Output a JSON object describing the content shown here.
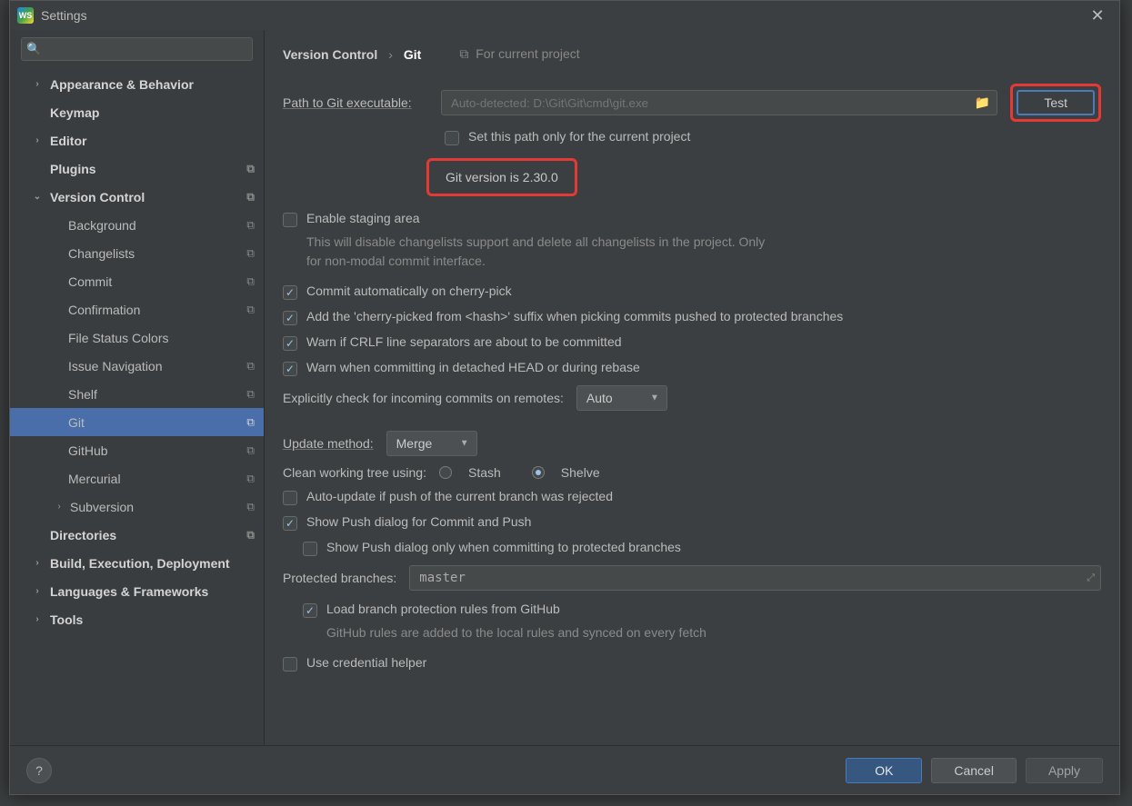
{
  "window": {
    "title": "Settings",
    "app_icon_text": "WS"
  },
  "sidebar": {
    "search_placeholder": "",
    "items": [
      {
        "label": "Appearance & Behavior",
        "level": "top",
        "arrow": "right"
      },
      {
        "label": "Keymap",
        "level": "top",
        "arrow": ""
      },
      {
        "label": "Editor",
        "level": "top",
        "arrow": "right"
      },
      {
        "label": "Plugins",
        "level": "top",
        "arrow": "",
        "copy": true
      },
      {
        "label": "Version Control",
        "level": "top",
        "arrow": "down",
        "copy": true
      },
      {
        "label": "Background",
        "level": "sub",
        "copy": true
      },
      {
        "label": "Changelists",
        "level": "sub",
        "copy": true
      },
      {
        "label": "Commit",
        "level": "sub",
        "copy": true
      },
      {
        "label": "Confirmation",
        "level": "sub",
        "copy": true
      },
      {
        "label": "File Status Colors",
        "level": "sub"
      },
      {
        "label": "Issue Navigation",
        "level": "sub",
        "copy": true
      },
      {
        "label": "Shelf",
        "level": "sub",
        "copy": true
      },
      {
        "label": "Git",
        "level": "sub",
        "copy": true,
        "selected": true
      },
      {
        "label": "GitHub",
        "level": "sub",
        "copy": true
      },
      {
        "label": "Mercurial",
        "level": "sub",
        "copy": true
      },
      {
        "label": "Subversion",
        "level": "sub2",
        "arrow": "right",
        "copy": true
      },
      {
        "label": "Directories",
        "level": "top",
        "arrow": "",
        "copy": true
      },
      {
        "label": "Build, Execution, Deployment",
        "level": "top",
        "arrow": "right"
      },
      {
        "label": "Languages & Frameworks",
        "level": "top",
        "arrow": "right"
      },
      {
        "label": "Tools",
        "level": "top",
        "arrow": "right"
      }
    ]
  },
  "breadcrumb": {
    "a": "Version Control",
    "b": "Git",
    "project_label": "For current project"
  },
  "git": {
    "path_label": "Path to Git executable:",
    "path_placeholder": "Auto-detected: D:\\Git\\Git\\cmd\\git.exe",
    "test_btn": "Test",
    "set_path_only": "Set this path only for the current project",
    "version_text": "Git version is 2.30.0",
    "enable_staging": "Enable staging area",
    "enable_staging_desc": "This will disable changelists support and delete all changelists in the project. Only for non-modal commit interface.",
    "commit_cherry": "Commit automatically on cherry-pick",
    "add_suffix": "Add the 'cherry-picked from <hash>' suffix when picking commits pushed to protected branches",
    "warn_crlf": "Warn if CRLF line separators are about to be committed",
    "warn_detached": "Warn when committing in detached HEAD or during rebase",
    "explicit_check": "Explicitly check for incoming commits on remotes:",
    "explicit_value": "Auto",
    "update_method_label": "Update method:",
    "update_method_value": "Merge",
    "clean_tree_label": "Clean working tree using:",
    "clean_stash": "Stash",
    "clean_shelve": "Shelve",
    "auto_update_push": "Auto-update if push of the current branch was rejected",
    "show_push_dialog": "Show Push dialog for Commit and Push",
    "show_push_protected": "Show Push dialog only when committing to protected branches",
    "protected_label": "Protected branches:",
    "protected_value": "master",
    "load_github_rules": "Load branch protection rules from GitHub",
    "load_github_desc": "GitHub rules are added to the local rules and synced on every fetch",
    "credential_helper": "Use credential helper"
  },
  "footer": {
    "ok": "OK",
    "cancel": "Cancel",
    "apply": "Apply"
  }
}
